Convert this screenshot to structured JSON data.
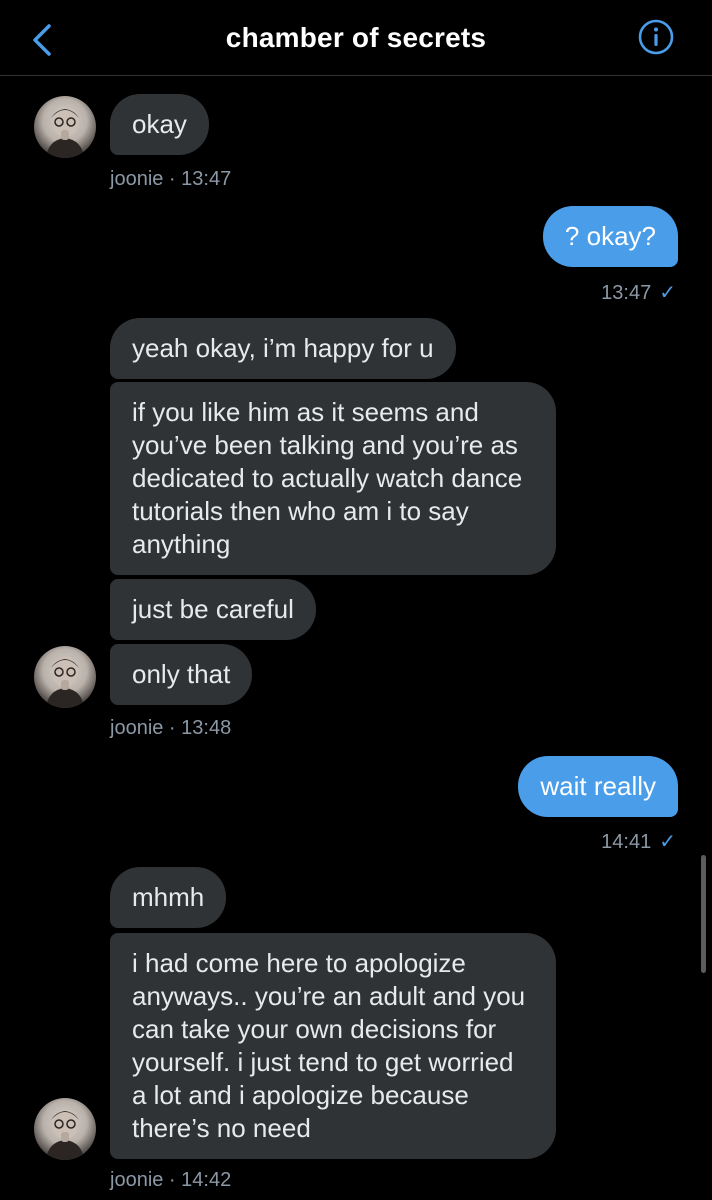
{
  "header": {
    "title": "chamber of secrets",
    "back_icon": "chevron-left-icon",
    "info_icon": "info-icon",
    "accent": "#4a9de8"
  },
  "messages": {
    "m1": "okay",
    "meta1": "joonie · 13:47",
    "m2": "? okay?",
    "meta2": "13:47",
    "m3": "yeah okay, i’m happy for u",
    "m4": "if you like him as it seems and you’ve been talking and you’re as dedicated to actually watch dance tutorials then who am i to say anything",
    "m5": "just be careful",
    "m6": "only that",
    "meta3": "joonie · 13:48",
    "m7": "wait really",
    "meta4": "14:41",
    "m8": "mhmh",
    "m9": "i had come here to apologize anyways.. you’re an adult and you can take your own decisions for yourself. i just tend to get worried a lot and i apologize because there’s no need",
    "meta5": "joonie · 14:42"
  },
  "colors": {
    "incoming_bubble": "#2f3336",
    "outgoing_bubble": "#4a9de8",
    "meta_text": "#8b98a5"
  }
}
